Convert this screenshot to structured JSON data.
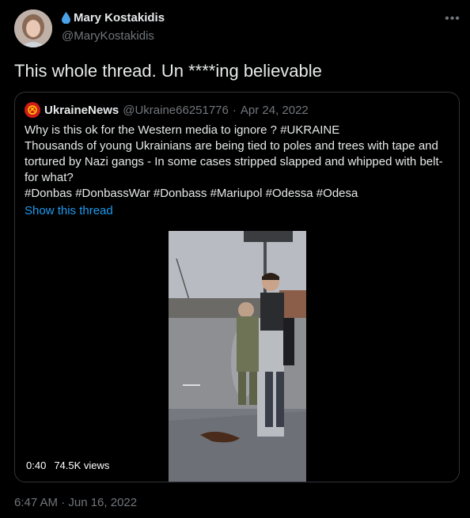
{
  "author": {
    "display_name": "Mary Kostakidis",
    "handle": "@MaryKostakidis",
    "emoji": "droplet-icon"
  },
  "tweet": {
    "text": "This whole thread. Un ****ing believable",
    "timestamp": "6:47 AM · Jun 16, 2022"
  },
  "quoted": {
    "name": "UkraineNews",
    "handle": "@Ukraine66251776",
    "dot": "·",
    "date": "Apr 24, 2022",
    "lines": [
      "Why is this ok for the Western media to ignore ? #UKRAINE",
      "Thousands of young Ukrainians are being tied to poles and trees with tape and",
      "tortured by Nazi gangs - In some cases stripped slapped and whipped with belt-",
      "for what?",
      "#Donbas #DonbassWar #Donbass #Mariupol #Odessa #Odesa"
    ],
    "show_thread": "Show this thread",
    "video": {
      "duration": "0:40",
      "views": "74.5K views"
    }
  },
  "colors": {
    "background": "#000000",
    "text": "#e7e9ea",
    "muted": "#71767b",
    "link": "#1d9bf0",
    "border": "#2f3336"
  }
}
